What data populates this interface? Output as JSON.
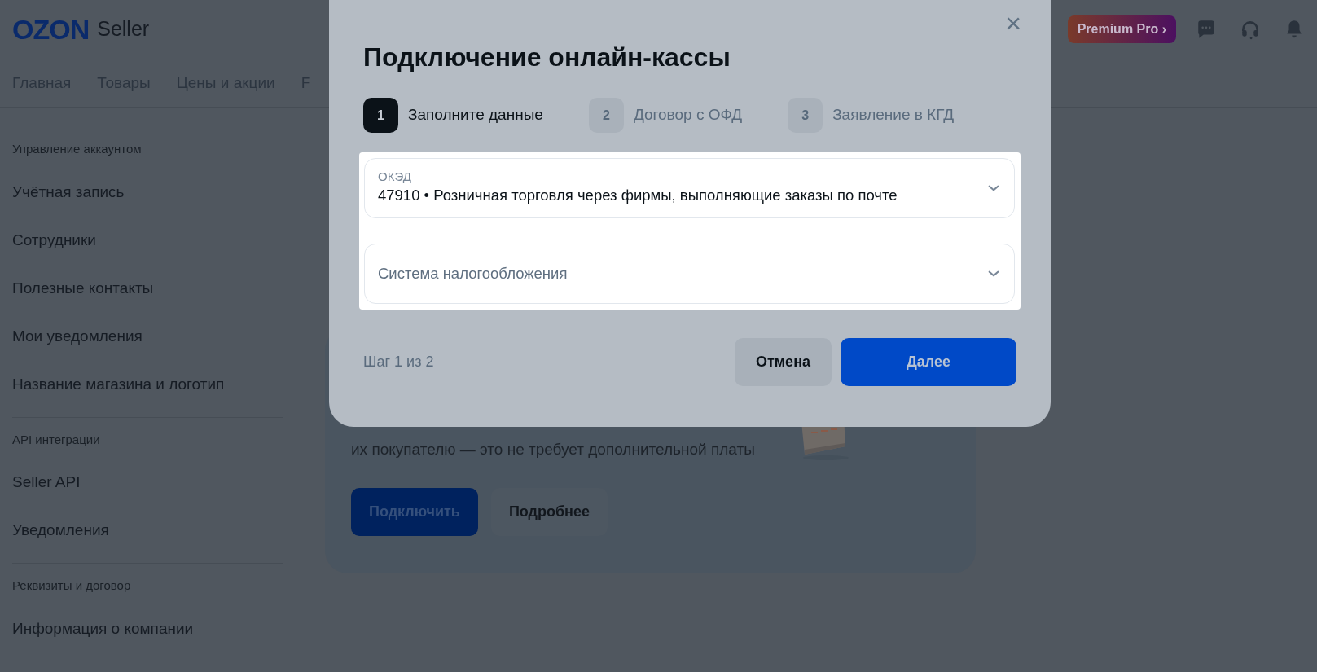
{
  "header": {
    "logo": "OZON",
    "logo_suffix": "Seller",
    "promo": "Premium Pro",
    "promo_chevron": "›"
  },
  "nav": [
    "Главная",
    "Товары",
    "Цены и акции",
    "F"
  ],
  "sidebar": [
    {
      "title": "Управление аккаунтом",
      "items": [
        "Учётная запись",
        "Сотрудники",
        "Полезные контакты",
        "Мои уведомления",
        "Название магазина и логотип"
      ]
    },
    {
      "title": "API интеграции",
      "items": [
        "Seller API",
        "Уведомления"
      ]
    },
    {
      "title": "Реквизиты и договор",
      "items": [
        "Информация о компании"
      ]
    }
  ],
  "promo_card": {
    "text": "их покупателю — это не требует дополнительной платы",
    "buttons": [
      {
        "label": "Подключить",
        "kind": "primary"
      },
      {
        "label": "Подробнее",
        "kind": "secondary"
      }
    ]
  },
  "modal": {
    "title": "Подключение онлайн-кассы",
    "close": "×",
    "steps": [
      {
        "number": "1",
        "label": "Заполните данные",
        "selected": true
      },
      {
        "number": "2",
        "label": "Договор с ОФД",
        "selected": false
      },
      {
        "number": "3",
        "label": "Заявление в КГД",
        "selected": false
      }
    ],
    "fields": [
      {
        "label": "ОКЭД",
        "value": "47910 • Розничная торговля через фирмы, выполняющие заказы по почте"
      },
      {
        "placeholder": "Система налогообложения"
      }
    ],
    "step_counter": "Шаг 1 из 2",
    "buttons": [
      {
        "label": "Отмена",
        "kind": "secondary"
      },
      {
        "label": "Далее",
        "kind": "primary"
      }
    ]
  }
}
